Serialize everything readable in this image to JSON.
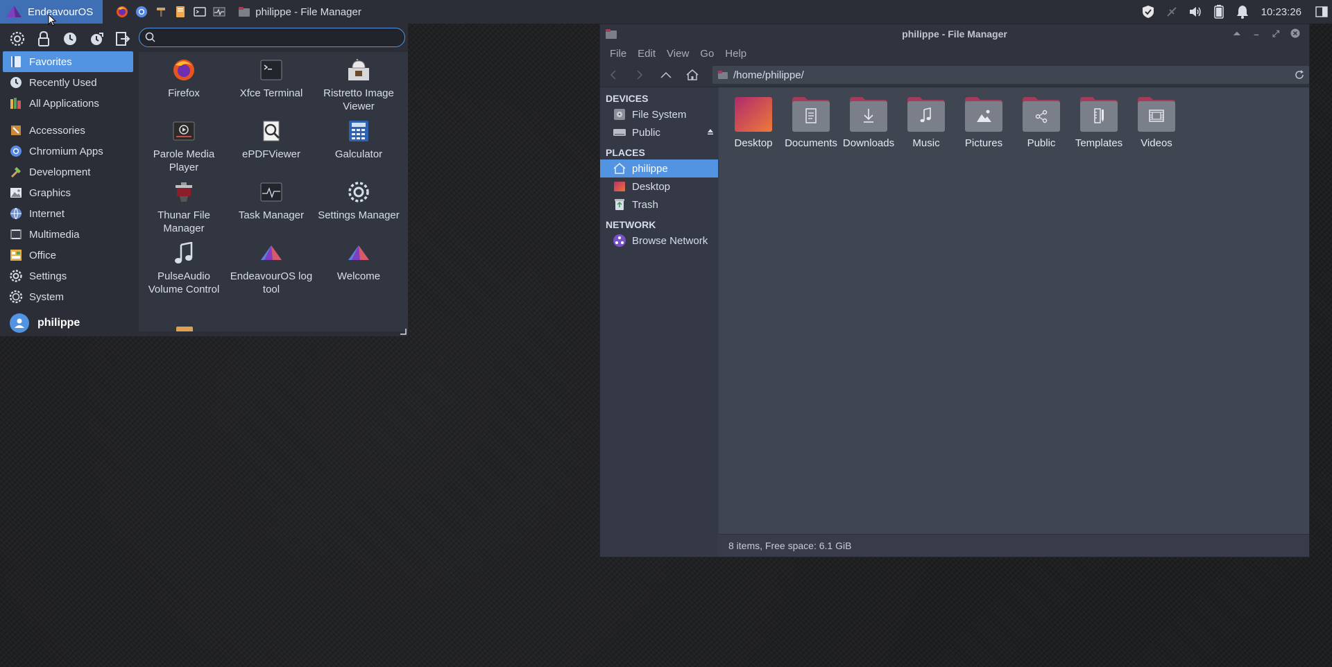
{
  "panel": {
    "start_label": "EndeavourOS",
    "task_title": "philippe - File Manager",
    "clock": "10:23:26",
    "launchers": [
      "firefox-icon",
      "chromium-icon",
      "hammer-icon",
      "notes-icon",
      "terminal-icon",
      "task-manager-icon"
    ],
    "tray": [
      "shield-icon",
      "network-disconnected-icon",
      "volume-icon",
      "battery-icon",
      "bell-icon"
    ]
  },
  "menu": {
    "search": {
      "value": "",
      "placeholder": ""
    },
    "categories": [
      {
        "label": "Favorites",
        "icon": "favorites-icon",
        "selected": true
      },
      {
        "label": "Recently Used",
        "icon": "recent-icon"
      },
      {
        "label": "All Applications",
        "icon": "all-apps-icon"
      },
      {
        "label": "Accessories",
        "icon": "accessories-icon"
      },
      {
        "label": "Chromium Apps",
        "icon": "chromium-icon"
      },
      {
        "label": "Development",
        "icon": "development-icon"
      },
      {
        "label": "Graphics",
        "icon": "graphics-icon"
      },
      {
        "label": "Internet",
        "icon": "internet-icon"
      },
      {
        "label": "Multimedia",
        "icon": "multimedia-icon"
      },
      {
        "label": "Office",
        "icon": "office-icon"
      },
      {
        "label": "Settings",
        "icon": "settings-icon"
      },
      {
        "label": "System",
        "icon": "system-icon"
      }
    ],
    "apps": [
      {
        "label": "Firefox",
        "icon": "firefox-icon"
      },
      {
        "label": "Xfce Terminal",
        "icon": "terminal-icon"
      },
      {
        "label": "Ristretto Image Viewer",
        "icon": "image-viewer-icon"
      },
      {
        "label": "Parole Media Player",
        "icon": "media-player-icon"
      },
      {
        "label": "ePDFViewer",
        "icon": "pdf-viewer-icon"
      },
      {
        "label": "Galculator",
        "icon": "calculator-icon"
      },
      {
        "label": "Thunar File Manager",
        "icon": "file-manager-icon"
      },
      {
        "label": "Task Manager",
        "icon": "task-manager-icon"
      },
      {
        "label": "Settings Manager",
        "icon": "settings-manager-icon"
      },
      {
        "label": "PulseAudio Volume Control",
        "icon": "volume-control-icon"
      },
      {
        "label": "EndeavourOS log tool",
        "icon": "endeavouros-icon"
      },
      {
        "label": "Welcome",
        "icon": "welcome-icon"
      }
    ],
    "user": "philippe"
  },
  "file_manager": {
    "title": "philippe - File Manager",
    "menubar": [
      "File",
      "Edit",
      "View",
      "Go",
      "Help"
    ],
    "path": "/home/philippe/",
    "sidebar": {
      "devices_header": "DEVICES",
      "devices": [
        {
          "label": "File System",
          "icon": "drive-icon"
        },
        {
          "label": "Public",
          "icon": "removable-drive-icon",
          "eject": true
        }
      ],
      "places_header": "PLACES",
      "places": [
        {
          "label": "philippe",
          "icon": "home-icon",
          "selected": true
        },
        {
          "label": "Desktop",
          "icon": "desktop-icon"
        },
        {
          "label": "Trash",
          "icon": "trash-icon"
        }
      ],
      "network_header": "NETWORK",
      "network": [
        {
          "label": "Browse Network",
          "icon": "network-icon"
        }
      ]
    },
    "folders": [
      {
        "label": "Desktop",
        "icon": "desktop-folder-icon"
      },
      {
        "label": "Documents",
        "icon": "documents-folder-icon"
      },
      {
        "label": "Downloads",
        "icon": "downloads-folder-icon"
      },
      {
        "label": "Music",
        "icon": "music-folder-icon"
      },
      {
        "label": "Pictures",
        "icon": "pictures-folder-icon"
      },
      {
        "label": "Public",
        "icon": "public-folder-icon"
      },
      {
        "label": "Templates",
        "icon": "templates-folder-icon"
      },
      {
        "label": "Videos",
        "icon": "videos-folder-icon"
      }
    ],
    "status": "8 items, Free space: 6.1 GiB"
  },
  "colors": {
    "accent": "#5294e2",
    "panel": "#2b2e37",
    "folder_top": "#a63a5a",
    "folder_body": "#7b7f89"
  }
}
